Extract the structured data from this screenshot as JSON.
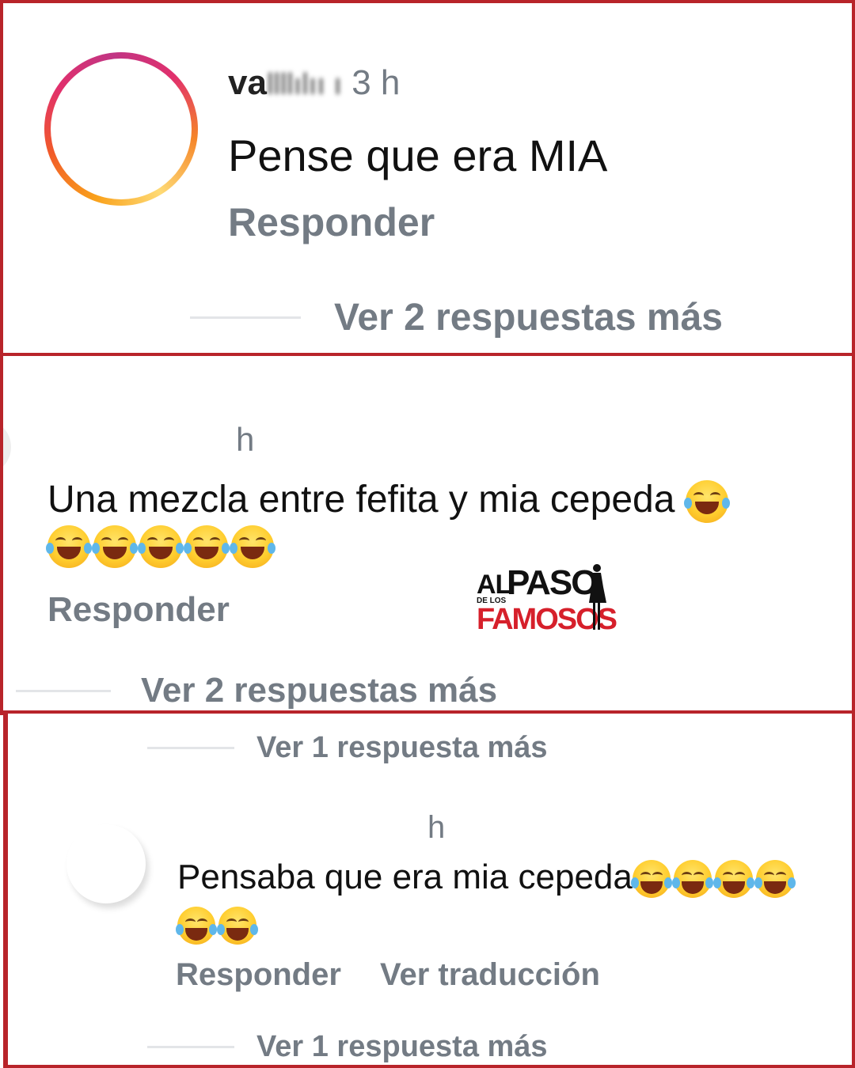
{
  "comments": [
    {
      "username": "va",
      "time": "3 h",
      "text": "Pense que era MIA",
      "reply_label": "Responder",
      "more_replies": "Ver 2 respuestas más"
    },
    {
      "time": "h",
      "text": "Una mezcla entre fefita y mia cepeda",
      "reply_label": "Responder",
      "more_replies": "Ver 2 respuestas más"
    },
    {
      "top_more_replies": "Ver 1 respuesta más",
      "time": "h",
      "text": "Pensaba que era mia cepeda",
      "reply_label": "Responder",
      "translate_label": "Ver traducción",
      "more_replies": "Ver 1 respuesta más"
    }
  ],
  "watermark": {
    "line1_a": "AL",
    "line1_b": "PASO",
    "small": "DE LOS",
    "line2": "FAMOSOS"
  },
  "icons": {
    "emoji": "face-with-tears-of-joy-icon"
  },
  "colors": {
    "border": "#b8242a",
    "muted_text": "#737b84",
    "logo_red": "#d6202b"
  }
}
